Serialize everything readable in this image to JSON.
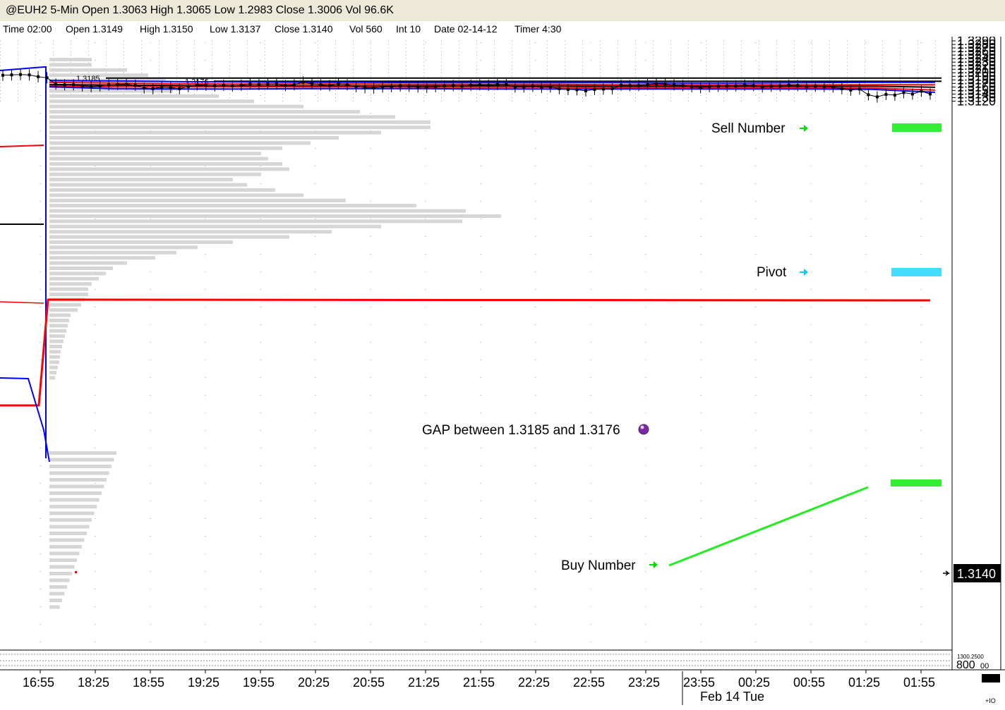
{
  "window": {
    "title": "@EUH2 5-Min Open 1.3063 High 1.3065 Low 1.2983 Close 1.3006 Vol 96.6K"
  },
  "info": {
    "time": "Time 02:00",
    "open": "Open 1.3149",
    "high": "High 1.3150",
    "low": "Low 1.3137",
    "close": "Close 1.3140",
    "vol": "Vol 560",
    "int": "Int 10",
    "date": "Date 02-14-12",
    "timer": "Timer 4:30"
  },
  "chart_data": {
    "type": "line",
    "symbol": "@EUH2",
    "interval": "5-Min",
    "ylim": [
      1.3118,
      1.3294
    ],
    "yticks": [
      "1.3290",
      "1.3280",
      "1.3270",
      "1.3260",
      "1.3250",
      "1.3240",
      "1.3230",
      "1.3220",
      "1.3210",
      "1.3200",
      "1.3190",
      "1.3180",
      "1.3170",
      "1.3160",
      "1.3150",
      "1.3140",
      "1.3130",
      "1.3120"
    ],
    "last_price": "1.3140",
    "x_ticks": [
      "16:55",
      "18:25",
      "18:55",
      "19:25",
      "19:55",
      "20:25",
      "20:55",
      "21:25",
      "21:55",
      "22:25",
      "22:55",
      "23:25",
      "23:55",
      "00:25",
      "00:55",
      "01:25",
      "01:55"
    ],
    "date_label": "Feb 14 Tue",
    "price_series": [
      1.3193,
      1.3194,
      1.3195,
      1.3194,
      1.3189,
      1.3186,
      1.3168,
      1.3166,
      1.3166,
      1.3163,
      1.3161,
      1.3163,
      1.3166,
      1.3167,
      1.3168,
      1.3165,
      1.3157,
      1.3155,
      1.3159,
      1.3158,
      1.3155,
      1.3161,
      1.3166,
      1.3165,
      1.3163,
      1.3165,
      1.3163,
      1.3165,
      1.3168,
      1.3167,
      1.3168,
      1.3168,
      1.3164,
      1.3166,
      1.3174,
      1.3169,
      1.3166,
      1.3164,
      1.3169,
      1.3166,
      1.3161,
      1.3158,
      1.3157,
      1.316,
      1.3161,
      1.3163,
      1.3162,
      1.316,
      1.3159,
      1.3161,
      1.3163,
      1.3164,
      1.3162,
      1.3165,
      1.3166,
      1.3165,
      1.3167,
      1.3167,
      1.316,
      1.316,
      1.3162,
      1.3159,
      1.316,
      1.3155,
      1.3153,
      1.3152,
      1.3149,
      1.3153,
      1.3154,
      1.3155,
      1.3165,
      1.3164,
      1.3164,
      1.3167,
      1.3169,
      1.3168,
      1.3166,
      1.3164,
      1.3161,
      1.3158,
      1.3161,
      1.3162,
      1.3163,
      1.3163,
      1.3165,
      1.3164,
      1.316,
      1.3162,
      1.3163,
      1.3165,
      1.3164,
      1.3161,
      1.3162,
      1.3161,
      1.316,
      1.3155,
      1.3151,
      1.3154,
      1.3138,
      1.3132,
      1.3139,
      1.3137,
      1.3144,
      1.314,
      1.3148,
      1.314
    ],
    "blue_upper": [
      1.3178,
      1.3177,
      1.3175,
      1.3174,
      1.3173,
      1.3173,
      1.3172,
      1.3172,
      1.3172,
      1.3172,
      1.3171,
      1.3171,
      1.3172,
      1.3173,
      1.3173
    ],
    "red_upper": [
      1.3173,
      1.3171,
      1.3169,
      1.3168,
      1.3168,
      1.3168,
      1.3167,
      1.3167,
      1.3167,
      1.3166,
      1.3166,
      1.3166,
      1.3166,
      1.3166,
      1.3166
    ],
    "black_mid": [
      1.3167,
      1.3165,
      1.3164,
      1.3163,
      1.3163,
      1.3163,
      1.3163,
      1.3163,
      1.3163,
      1.3162,
      1.3162,
      1.3162,
      1.3162,
      1.3162,
      1.3159
    ],
    "red_lower": [
      1.3163,
      1.316,
      1.316,
      1.316,
      1.316,
      1.316,
      1.3159,
      1.3159,
      1.3159,
      1.3158,
      1.3158,
      1.3158,
      1.3158,
      1.3157,
      1.3151
    ],
    "blue_lower": [
      1.316,
      1.3155,
      1.3154,
      1.3154,
      1.3155,
      1.3155,
      1.3155,
      1.3154,
      1.3154,
      1.3154,
      1.3154,
      1.3154,
      1.3154,
      1.3153,
      1.3145
    ],
    "levels": [
      {
        "price": 1.3185,
        "label": "1.3185"
      },
      {
        "price": 1.3176,
        "label": "1.3176"
      },
      {
        "price": 1.3218,
        "label": ""
      }
    ]
  },
  "annotations": {
    "sell_number": "Sell Number",
    "pivot": "Pivot",
    "gap": "GAP between 1.3185 and 1.3176",
    "buy_number": "Buy Number"
  },
  "lower_panel": {
    "label_a": "1300.2500",
    "label_b": "800",
    "label_c": "00",
    "label_d": "+IO"
  },
  "colors": {
    "blue": "#0000ff",
    "red": "#ff0000",
    "green": "#00ee00",
    "cyan": "#00ffff",
    "profile": "#d6d6d6"
  }
}
